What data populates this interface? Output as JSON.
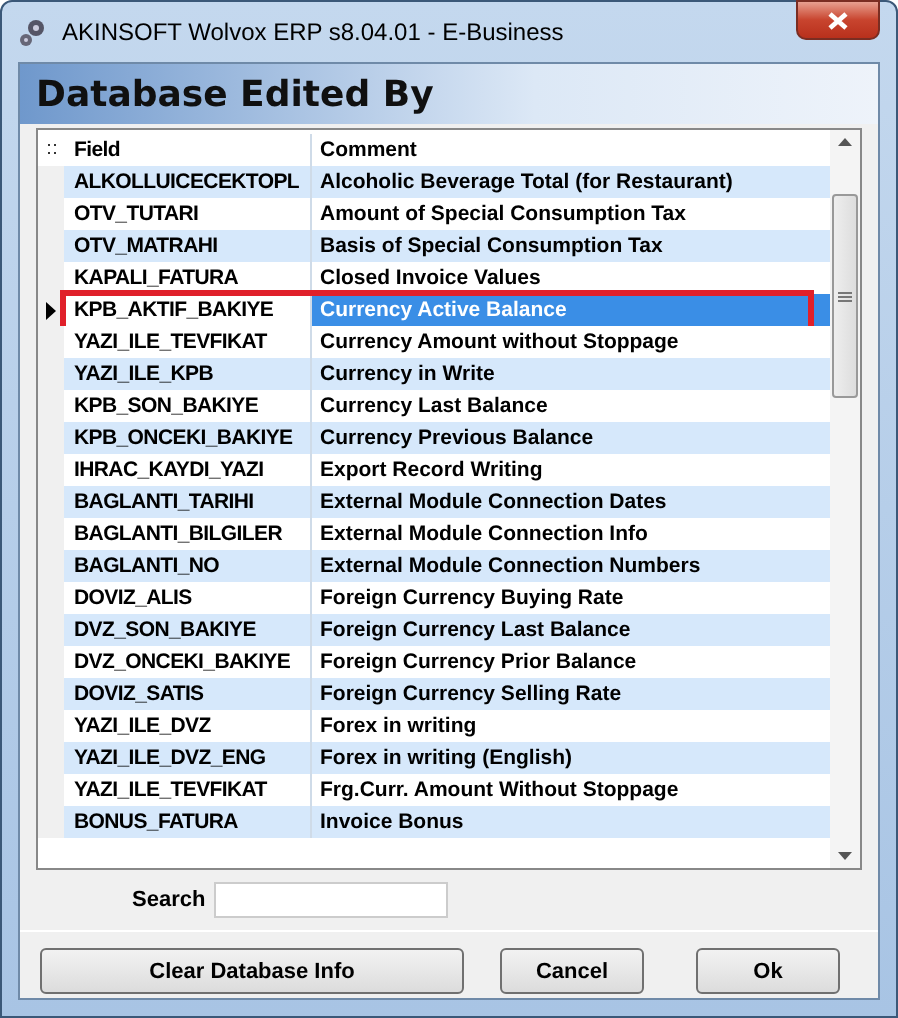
{
  "window": {
    "title": "AKINSOFT Wolvox ERP s8.04.01 - E-Business"
  },
  "header": {
    "title": "Database Edited By"
  },
  "table": {
    "columns": [
      "Field",
      "Comment"
    ],
    "rows": [
      {
        "field": "ALKOLLUICECEKTOPL",
        "comment": "Alcoholic Beverage Total (for Restaurant)",
        "selected": false
      },
      {
        "field": "OTV_TUTARI",
        "comment": "Amount of Special Consumption Tax",
        "selected": false
      },
      {
        "field": "OTV_MATRAHI",
        "comment": "Basis of Special Consumption Tax",
        "selected": false
      },
      {
        "field": "KAPALI_FATURA",
        "comment": "Closed Invoice Values",
        "selected": false
      },
      {
        "field": "KPB_AKTIF_BAKIYE",
        "comment": "Currency Active Balance",
        "selected": true
      },
      {
        "field": "YAZI_ILE_TEVFIKAT",
        "comment": "Currency Amount without Stoppage",
        "selected": false
      },
      {
        "field": "YAZI_ILE_KPB",
        "comment": "Currency in Write",
        "selected": false
      },
      {
        "field": "KPB_SON_BAKIYE",
        "comment": "Currency Last Balance",
        "selected": false
      },
      {
        "field": "KPB_ONCEKI_BAKIYE",
        "comment": "Currency Previous Balance",
        "selected": false
      },
      {
        "field": "IHRAC_KAYDI_YAZI",
        "comment": "Export Record Writing",
        "selected": false
      },
      {
        "field": "BAGLANTI_TARIHI",
        "comment": "External Module Connection Dates",
        "selected": false
      },
      {
        "field": "BAGLANTI_BILGILER",
        "comment": "External Module Connection Info",
        "selected": false
      },
      {
        "field": "BAGLANTI_NO",
        "comment": "External Module Connection Numbers",
        "selected": false
      },
      {
        "field": "DOVIZ_ALIS",
        "comment": "Foreign Currency Buying Rate",
        "selected": false
      },
      {
        "field": "DVZ_SON_BAKIYE",
        "comment": "Foreign Currency Last Balance",
        "selected": false
      },
      {
        "field": "DVZ_ONCEKI_BAKIYE",
        "comment": "Foreign Currency Prior Balance",
        "selected": false
      },
      {
        "field": "DOVIZ_SATIS",
        "comment": "Foreign Currency Selling Rate",
        "selected": false
      },
      {
        "field": "YAZI_ILE_DVZ",
        "comment": "Forex in writing",
        "selected": false
      },
      {
        "field": "YAZI_ILE_DVZ_ENG",
        "comment": "Forex in writing (English)",
        "selected": false
      },
      {
        "field": "YAZI_ILE_TEVFIKAT",
        "comment": "Frg.Curr. Amount Without Stoppage",
        "selected": false
      },
      {
        "field": "BONUS_FATURA",
        "comment": "Invoice Bonus",
        "selected": false
      }
    ]
  },
  "search": {
    "label": "Search"
  },
  "buttons": [
    "Clear Database Info",
    "Cancel",
    "Ok"
  ]
}
